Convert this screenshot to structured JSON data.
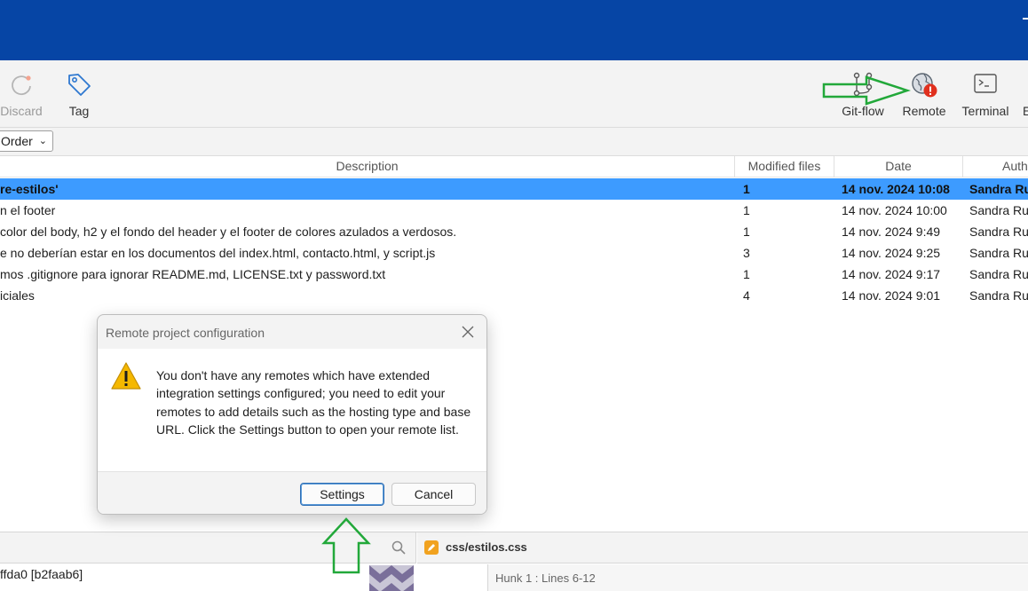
{
  "toolbar": {
    "items": [
      {
        "label": "Discard",
        "icon": "discard-icon"
      },
      {
        "label": "Tag",
        "icon": "tag-icon"
      },
      {
        "label": "Git-flow",
        "icon": "git-flow-icon"
      },
      {
        "label": "Remote",
        "icon": "remote-globe-icon"
      },
      {
        "label": "Terminal",
        "icon": "terminal-icon"
      },
      {
        "label": "E",
        "icon": ""
      }
    ]
  },
  "filter": {
    "order_label": "Order"
  },
  "table": {
    "columns": [
      "Description",
      "Modified files",
      "Date",
      "Auth"
    ],
    "rows": [
      {
        "description": "re-estilos'",
        "files": "1",
        "date": "14 nov. 2024 10:08",
        "author": "Sandra Ru"
      },
      {
        "description": "n el footer",
        "files": "1",
        "date": "14 nov. 2024 10:00",
        "author": "Sandra Ru"
      },
      {
        "description": "color del body, h2 y el fondo del header y el footer de colores azulados a verdosos.",
        "files": "1",
        "date": "14 nov. 2024 9:49",
        "author": "Sandra Ru"
      },
      {
        "description": "e no deberían estar en los documentos del index.html, contacto.html, y script.js",
        "files": "3",
        "date": "14 nov. 2024 9:25",
        "author": "Sandra Ru"
      },
      {
        "description": "mos .gitignore para ignorar README.md, LICENSE.txt y password.txt",
        "files": "1",
        "date": "14 nov. 2024 9:17",
        "author": "Sandra Ru"
      },
      {
        "description": "iciales",
        "files": "4",
        "date": "14 nov. 2024 9:01",
        "author": "Sandra Ru"
      }
    ]
  },
  "bottom": {
    "file_name": "css/estilos.css",
    "commit_ref": "ffda0 [b2faab6]",
    "hunk": "Hunk 1 : Lines 6-12"
  },
  "dialog": {
    "title": "Remote project configuration",
    "message": "You don't have any remotes which have extended integration settings configured; you need to edit your remotes to add details such as the hosting type and base URL. Click the Settings button to open your remote list.",
    "settings_label": "Settings",
    "cancel_label": "Cancel"
  },
  "colors": {
    "titlebar": "#0645a5",
    "selected_row": "#3d9bff",
    "annotation_arrow": "#22a83a",
    "error_badge": "#e0301e",
    "warning": "#f5b800"
  }
}
